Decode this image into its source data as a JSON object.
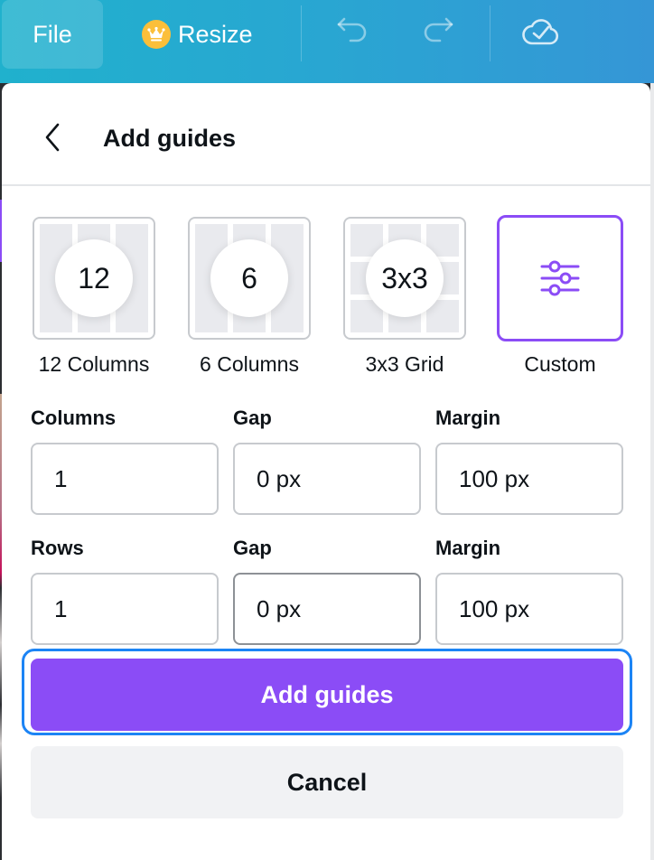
{
  "topbar": {
    "file_label": "File",
    "resize_label": "Resize",
    "icons": {
      "crown": "crown-icon",
      "undo": "undo-icon",
      "redo": "redo-icon",
      "cloud_saved": "cloud-check-icon"
    }
  },
  "panel": {
    "title": "Add guides",
    "back_icon": "chevron-left-icon",
    "presets": [
      {
        "badge": "12",
        "label": "12 Columns",
        "selected": false
      },
      {
        "badge": "6",
        "label": "6 Columns",
        "selected": false
      },
      {
        "badge": "3x3",
        "label": "3x3 Grid",
        "selected": false
      },
      {
        "badge": "",
        "label": "Custom",
        "selected": true,
        "icon": "sliders-icon"
      }
    ],
    "columns_row": {
      "count_label": "Columns",
      "count_value": "1",
      "gap_label": "Gap",
      "gap_value": "0 px",
      "margin_label": "Margin",
      "margin_value": "100 px"
    },
    "rows_row": {
      "count_label": "Rows",
      "count_value": "1",
      "gap_label": "Gap",
      "gap_value": "0 px",
      "margin_label": "Margin",
      "margin_value": "100 px"
    },
    "primary_button": "Add guides",
    "secondary_button": "Cancel"
  },
  "colors": {
    "accent": "#8b4cf6",
    "focus_ring": "#1c84f5",
    "crown": "#fbbf3a",
    "topbar_start": "#20b1cd",
    "topbar_end": "#3596d6"
  }
}
